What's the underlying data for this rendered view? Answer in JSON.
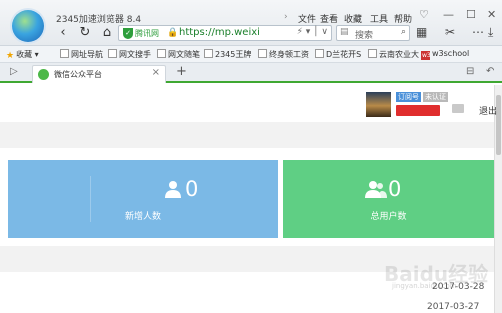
{
  "browser": {
    "name": "2345加速浏览器 8.4",
    "menu": [
      "文件",
      "查看",
      "收藏",
      "工具",
      "帮助"
    ],
    "address": {
      "secure_label": "腾讯网",
      "url": "https://mp.weixi",
      "dropdown_icon": "chevron-down"
    },
    "search": {
      "placeholder": "搜索"
    }
  },
  "bookmarks": {
    "favorites_label": "收藏",
    "items": [
      "网址导航",
      "网文搜手",
      "网文随笔",
      "2345王牌",
      "终身顿工资",
      "D兰花开S",
      "云南农业大",
      "w3school"
    ]
  },
  "tab": {
    "title": "微信公众平台"
  },
  "account": {
    "badge_type": "订阅号",
    "badge_status": "未认证",
    "logout": "退出"
  },
  "stats": [
    {
      "count": "0",
      "label": "新增人数",
      "color": "#7bb9e6"
    },
    {
      "count": "0",
      "label": "总用户数",
      "color": "#5fcf84"
    }
  ],
  "dates": [
    "2017-03-28",
    "2017-03-27"
  ],
  "watermark": {
    "main": "Baidu经验",
    "sub": "jingyan.baidu.com"
  }
}
